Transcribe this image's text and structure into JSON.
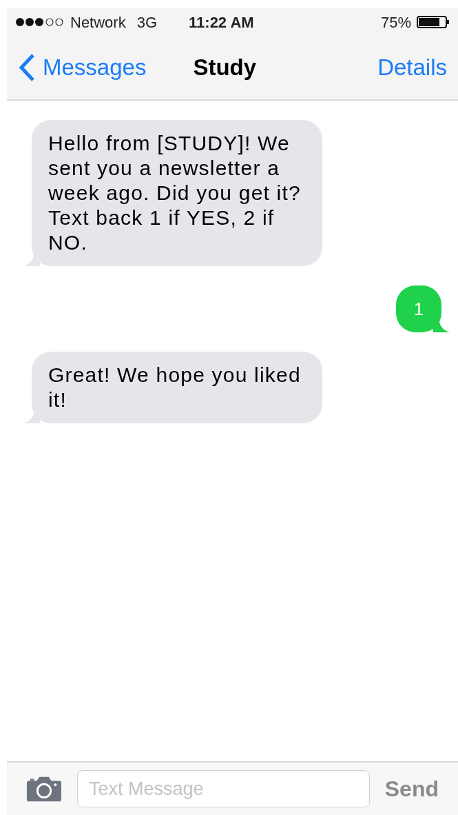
{
  "status_bar": {
    "carrier": "Network",
    "network": "3G",
    "time": "11:22 AM",
    "battery": "75%"
  },
  "nav": {
    "back": "Messages",
    "title": "Study",
    "action": "Details"
  },
  "messages": [
    {
      "kind": "incoming",
      "text": "Hello from [STUDY]! We sent you a newsletter a week ago. Did you get it? Text back 1 if YES, 2 if NO."
    },
    {
      "kind": "outgoing",
      "text": "1"
    },
    {
      "kind": "incoming",
      "text": "Great! We hope you liked it!"
    }
  ],
  "composer": {
    "placeholder": "Text Message",
    "send": "Send"
  }
}
